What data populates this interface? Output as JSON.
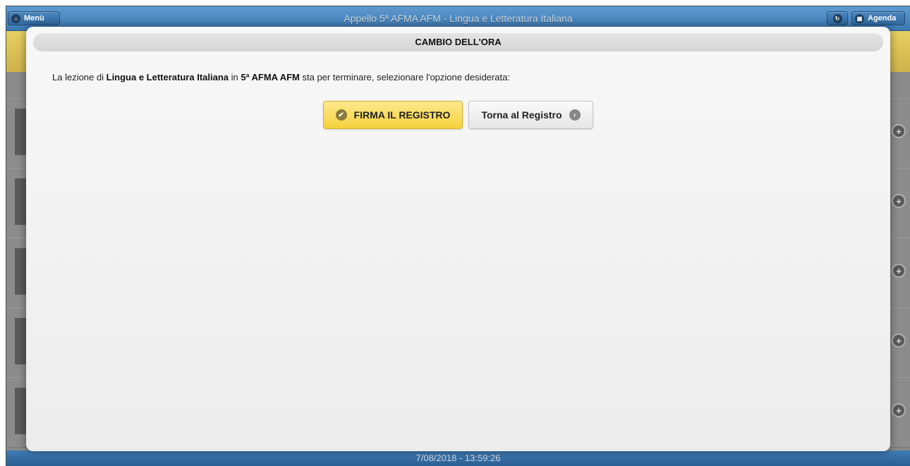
{
  "header": {
    "menu_label": "Menù",
    "title": "Appello 5ª AFMA AFM - Lingua e Letteratura Italiana",
    "agenda_label": "Agenda"
  },
  "footer": {
    "datetime": "7/08/2018 - 13:59:26"
  },
  "modal": {
    "title": "CAMBIO DELL'ORA",
    "message": {
      "prefix": "La lezione di ",
      "subject": "Lingua e Letteratura Italiana",
      "mid": " in ",
      "class_name": "5ª AFMA AFM",
      "suffix": " sta per terminare, selezionare l'opzione desiderata:"
    },
    "primary_button": "FIRMA IL REGISTRO",
    "secondary_button": "Torna al Registro"
  },
  "icons": {
    "menu": "home-icon",
    "refresh": "refresh-icon",
    "agenda": "calendar-icon",
    "primary": "check-icon",
    "secondary": "arrow-right-icon",
    "row_action": "plus-icon"
  },
  "colors": {
    "header": "#3b78b2",
    "primary_button": "#f6d13c",
    "subheader": "#cdb34a"
  }
}
